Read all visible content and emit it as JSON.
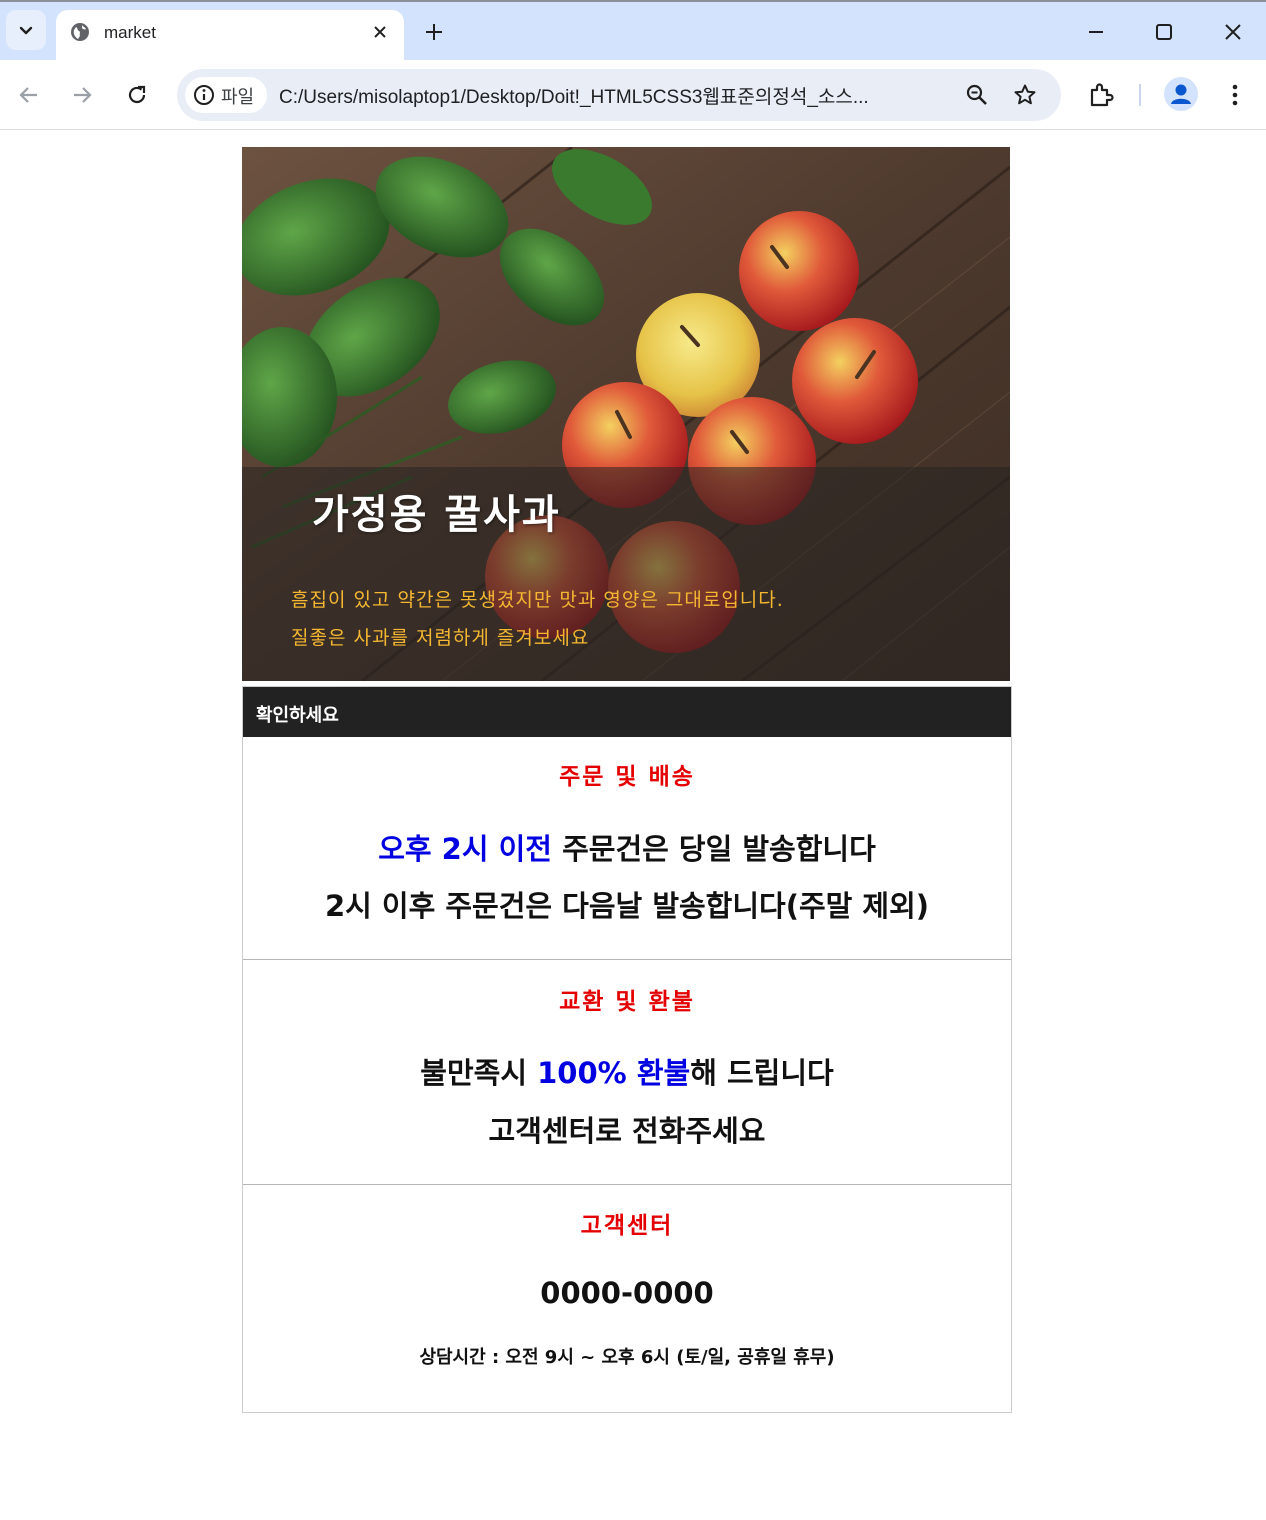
{
  "browser": {
    "tab_title": "market",
    "chip_label": "파일",
    "url": "C:/Users/misolaptop1/Desktop/Doit!_HTML5CSS3웹표준의정석_소스..."
  },
  "hero": {
    "title": "가정용 꿀사과",
    "line1": "흠집이 있고 약간은 못생겼지만 맛과 영양은 그대로입니다.",
    "line2": "질좋은 사과를 저렴하게 즐겨보세요"
  },
  "notice": {
    "header": "확인하세요",
    "sections": [
      {
        "title": "주문 및 배송",
        "line1_highlight": "오후 2시 이전",
        "line1_rest": " 주문건은 당일 발송합니다",
        "line2": "2시 이후 주문건은 다음날 발송합니다(주말 제외)"
      },
      {
        "title": "교환 및 환불",
        "line1_pre": "불만족시 ",
        "line1_highlight": "100% 환불",
        "line1_post": "해 드립니다",
        "line2": "고객센터로 전화주세요"
      },
      {
        "title": "고객센터",
        "phone": "0000-0000",
        "hours": "상담시간 : 오전 9시 ~ 오후 6시 (토/일, 공휴일 휴무)"
      }
    ]
  },
  "colors": {
    "section_title": "#e40000",
    "highlight": "#0000e0",
    "hero_text": "#f5b731",
    "header_bg": "#222222"
  },
  "icons": [
    "chevron-down-icon",
    "globe-icon",
    "close-icon",
    "plus-icon",
    "minimize-icon",
    "maximize-icon",
    "back-icon",
    "forward-icon",
    "reload-icon",
    "info-icon",
    "zoom-icon",
    "star-icon",
    "extensions-icon",
    "profile-icon",
    "more-vert-icon"
  ]
}
